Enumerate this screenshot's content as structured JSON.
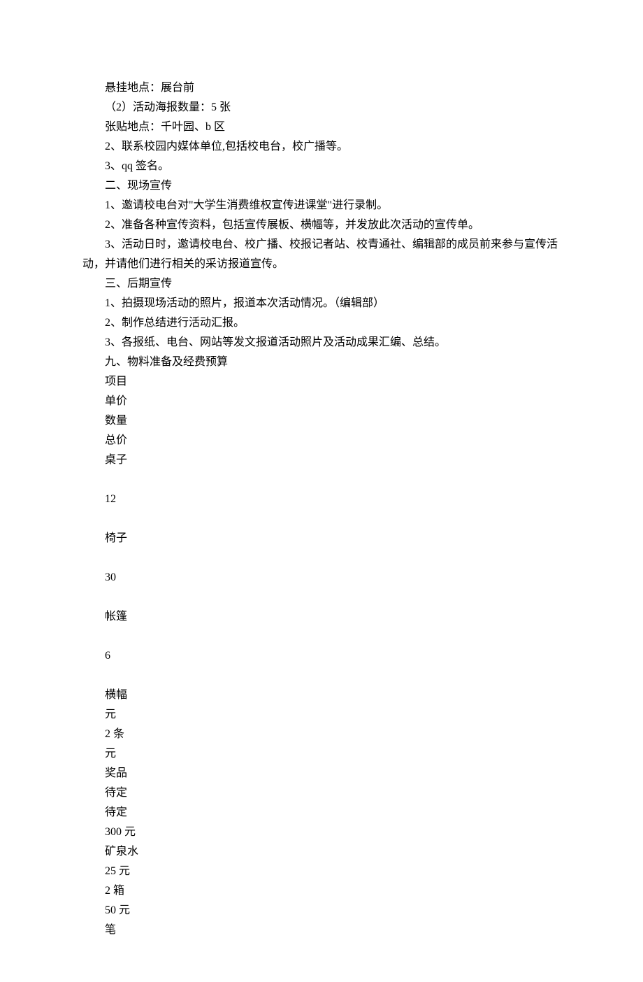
{
  "lines": [
    "悬挂地点：展台前",
    "（2）活动海报数量：5 张",
    "张贴地点：千叶园、b 区",
    "2、联系校园内媒体单位,包括校电台，校广播等。",
    "3、qq 签名。",
    "二、现场宣传",
    "1、邀请校电台对\"大学生消费维权宣传进课堂\"进行录制。",
    "2、准备各种宣传资料，包括宣传展板、横幅等，并发放此次活动的宣传单。",
    "3、活动日时，邀请校电台、校广播、校报记者站、校青通社、编辑部的成员前来参与宣传活动，并请他们进行相关的采访报道宣传。",
    "三、后期宣传",
    "1、拍摄现场活动的照片，报道本次活动情况。（编辑部）",
    "2、制作总结进行活动汇报。",
    "3、各报纸、电台、网站等发文报道活动照片及活动成果汇编、总结。",
    "九、物料准备及经费预算",
    "项目",
    "单价",
    "数量",
    "总价",
    "桌子",
    "",
    "12",
    "",
    "椅子",
    "",
    "30",
    "",
    "帐篷",
    "",
    "6",
    "",
    "横幅",
    "元",
    "2 条",
    "元",
    "奖品",
    "待定",
    "待定",
    "300 元",
    "矿泉水",
    "25 元",
    "2 箱",
    "50 元",
    "笔"
  ],
  "wrap_second": {
    "8": true
  }
}
